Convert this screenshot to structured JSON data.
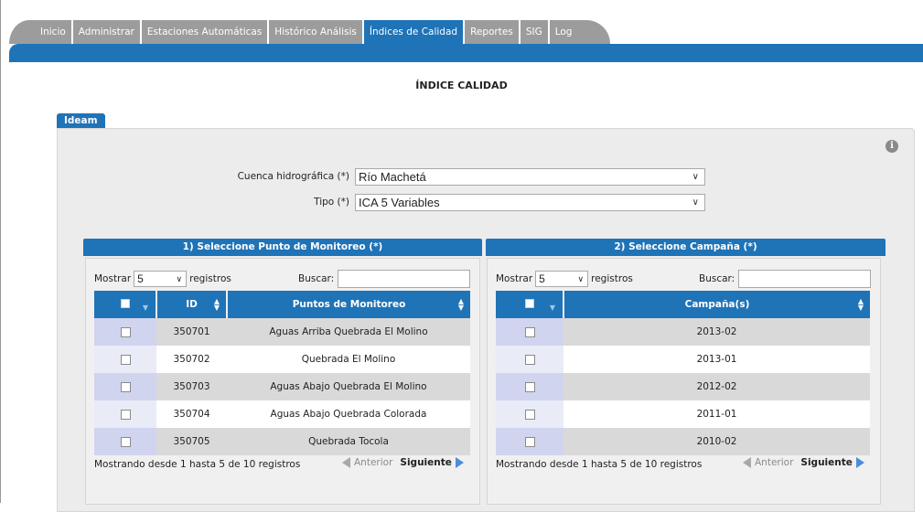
{
  "nav": {
    "tabs": [
      {
        "label": "Inicio"
      },
      {
        "label": "Administrar"
      },
      {
        "label": "Estaciones Automáticas"
      },
      {
        "label": "Histórico Análisis"
      },
      {
        "label": "Índices de Calidad"
      },
      {
        "label": "Reportes"
      },
      {
        "label": "SIG"
      },
      {
        "label": "Log"
      }
    ],
    "active": "Índices de Calidad"
  },
  "page": {
    "title": "ÍNDICE CALIDAD"
  },
  "panel_tab": {
    "label": "Ideam"
  },
  "info_icon": {
    "glyph": "i",
    "icon": "info-icon"
  },
  "form": {
    "cuenca": {
      "label": "Cuenca hidrográfica (*)",
      "value": "Río Machetá"
    },
    "tipo": {
      "label": "Tipo (*)",
      "value": "ICA 5 Variables"
    }
  },
  "left": {
    "header": "1) Seleccione Punto de Monitoreo (*)",
    "show_label": "Mostrar",
    "show_value": "5",
    "records_label": "registros",
    "search_label": "Buscar:",
    "columns": [
      "ID",
      "Puntos de Monitoreo"
    ],
    "rows": [
      {
        "id": "350701",
        "name": "Aguas Arriba Quebrada El Molino"
      },
      {
        "id": "350702",
        "name": "Quebrada El Molino"
      },
      {
        "id": "350703",
        "name": "Aguas Abajo Quebrada El Molino"
      },
      {
        "id": "350704",
        "name": "Aguas Abajo Quebrada Colorada"
      },
      {
        "id": "350705",
        "name": "Quebrada Tocola"
      }
    ],
    "info": "Mostrando desde 1 hasta 5 de 10 registros",
    "prev": "Anterior",
    "next": "Siguiente"
  },
  "right": {
    "header": "2) Seleccione Campaña (*)",
    "show_label": "Mostrar",
    "show_value": "5",
    "records_label": "registros",
    "search_label": "Buscar:",
    "columns": [
      "Campaña(s)"
    ],
    "rows": [
      {
        "campaign": "2013-02"
      },
      {
        "campaign": "2013-01"
      },
      {
        "campaign": "2012-02"
      },
      {
        "campaign": "2011-01"
      },
      {
        "campaign": "2010-02"
      }
    ],
    "info": "Mostrando desde 1 hasta 5 de 10 registros",
    "prev": "Anterior",
    "next": "Siguiente"
  },
  "colors": {
    "accent": "#1f73b7",
    "inactive_tab": "#9c9c9c",
    "row_odd": "#d9d9d9",
    "check_column": "#d0d4ef"
  }
}
